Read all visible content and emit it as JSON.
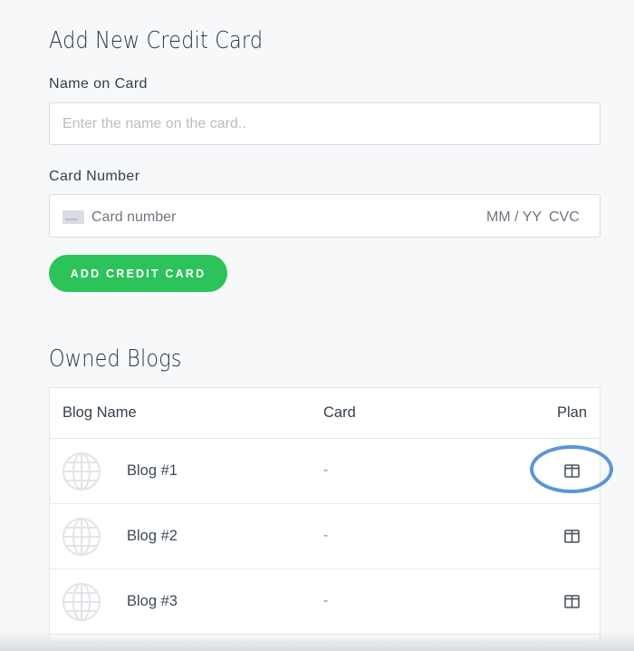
{
  "credit_card_form": {
    "title": "Add New Credit Card",
    "name_label": "Name on Card",
    "name_placeholder": "Enter the name on the card..",
    "name_value": "",
    "number_label": "Card Number",
    "number_placeholder": "Card number",
    "expiry_placeholder": "MM / YY",
    "cvc_placeholder": "CVC",
    "submit_label": "ADD CREDIT CARD",
    "icons": {
      "card": "credit-card-icon"
    }
  },
  "owned_blogs": {
    "title": "Owned Blogs",
    "columns": [
      "Blog Name",
      "Card",
      "Plan"
    ],
    "rows": [
      {
        "name": "Blog #1",
        "card": "-",
        "icon": "globe-icon",
        "plan_icon": "plan-icon"
      },
      {
        "name": "Blog #2",
        "card": "-",
        "icon": "globe-icon",
        "plan_icon": "plan-icon"
      },
      {
        "name": "Blog #3",
        "card": "-",
        "icon": "globe-icon",
        "plan_icon": "plan-icon"
      }
    ]
  },
  "colors": {
    "primary_button": "#2cc35a",
    "highlight_ring": "#5b95d9",
    "background": "#f7f8f9"
  }
}
